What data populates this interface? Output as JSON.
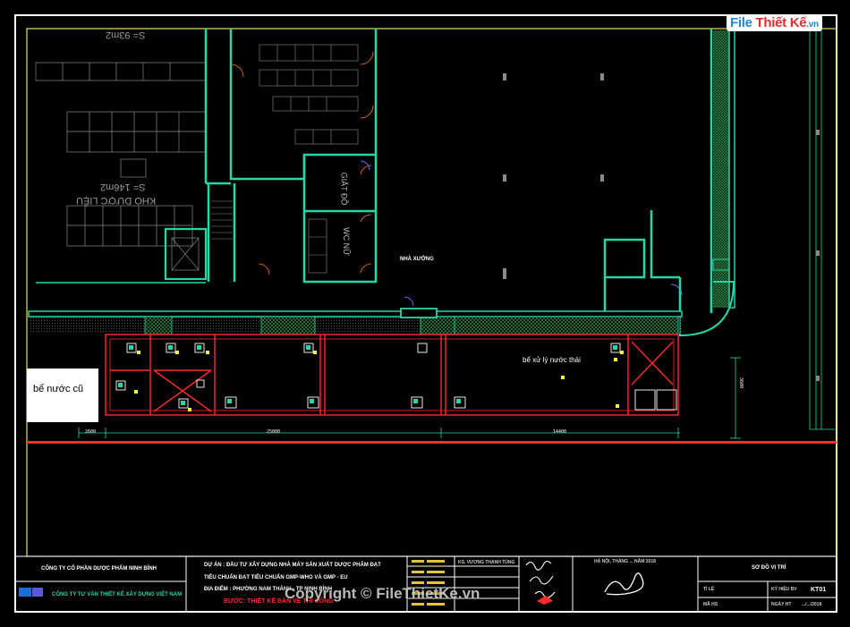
{
  "brand": {
    "logo_text": "File Thiết Kế",
    "logo_domain": ".vn",
    "colors": {
      "file": "#1a88d6",
      "thiet_ke": "#e02d2d",
      "vn": "#1a88d6"
    }
  },
  "watermark": {
    "text": "Copyright © FileThietKe.vn"
  },
  "plan": {
    "existing_tank_label": "bể nước cũ",
    "treatment_tank_label": "bể xử lý nước thải",
    "workshop_label": "NHÀ XƯỞNG",
    "warehouse_label": "KHO DƯỢC LIỆU",
    "warehouse_area": "S= 146m2",
    "laundry_label": "GIẶT ĐỒ",
    "wc_label": "WC NỮ",
    "top_area": "S= 93m2",
    "dims": {
      "d1": "2600",
      "d2": "25000",
      "d3": "14400",
      "v1": "3600"
    },
    "colors": {
      "wall": "#27d6a8",
      "tank": "#ff2a2a",
      "frame": "#e6e64a",
      "white": "#ffffff",
      "hatch": "#2f8f4a",
      "column": "#8a8a8a"
    }
  },
  "title_block": {
    "company": "CÔNG TY CỔ PHẦN DƯỢC PHẨM NINH BÌNH",
    "consultant": "CÔNG TY TƯ VẤN THIẾT KẾ XÂY DỰNG VIỆT NAM",
    "project_line1": "DỰ ÁN : ĐẦU TƯ XÂY DỰNG NHÀ MÁY SẢN XUẤT DƯỢC PHẨM ĐẠT",
    "project_line2": "TIÊU CHUẨN ĐẠT TIÊU CHUẨN GMP-WHO VÀ GMP - EU",
    "location": "ĐỊA ĐIỂM : PHƯỜNG NAM THÀNH - TP NINH BÌNH",
    "stage": "BƯỚC: THIẾT KẾ BẢN VẼ THI CÔNG",
    "engineer": "KS. VƯƠNG THANH TÙNG",
    "date_text": "HÀ NỘI, THÁNG ... NĂM 2018",
    "drawing_title": "SƠ ĐỒ VỊ TRÍ",
    "scale_label": "TỈ LỆ",
    "sheet_label": "KÝ HIỆU BV",
    "sheet_no": "KT01",
    "code_label": "MÃ HS",
    "date_label": "NGÀY HT",
    "date_value": ".../.../2018"
  }
}
